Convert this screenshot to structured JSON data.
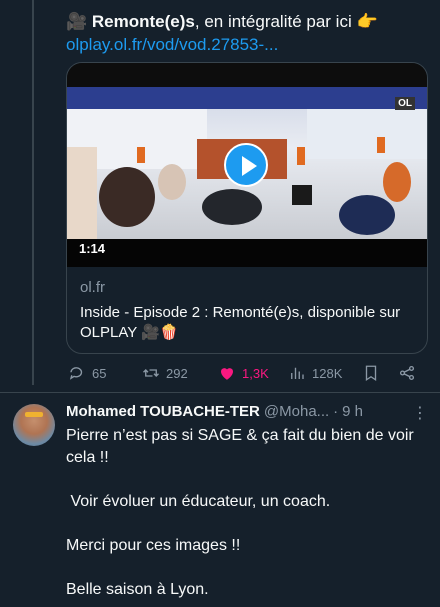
{
  "tweet": {
    "prefix_emoji": "🎥",
    "title_bold": "Remonte(e)s",
    "title_rest": ", en intégralité par ici",
    "suffix_emoji": "👉",
    "link": "olplay.ol.fr/vod/vod.27853-..."
  },
  "card": {
    "duration": "1:14",
    "domain": "ol.fr",
    "title": "Inside - Episode 2 : Remonté(e)s, disponible sur OLPLAY 🎥🍿",
    "watermark": "OL"
  },
  "actions": {
    "replies": "65",
    "retweets": "292",
    "likes": "1,3K",
    "views": "128K"
  },
  "reply": {
    "name": "Mohamed TOUBACHE-TER",
    "handle": "@Moha...",
    "separator": "·",
    "time": "9 h",
    "more": "⋮",
    "lines": [
      "Pierre n’est pas si SAGE & ça fait du bien de voir cela !!",
      " Voir évoluer un éducateur, un coach.",
      "Merci pour ces images !!",
      "Belle saison à Lyon."
    ]
  }
}
